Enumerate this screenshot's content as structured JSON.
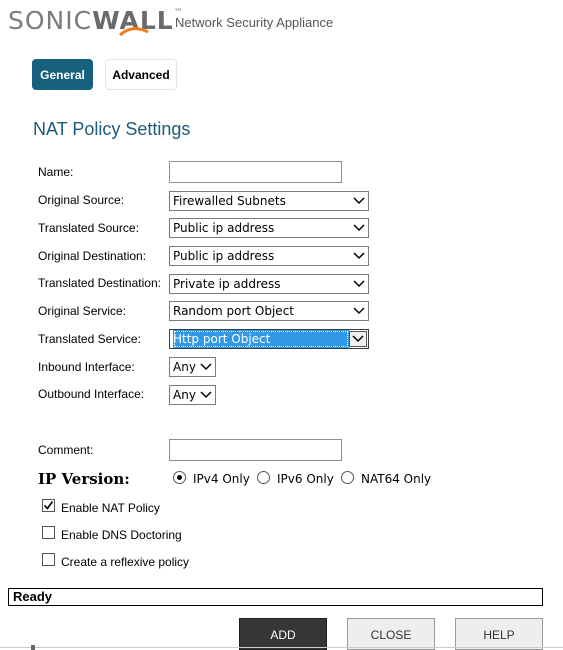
{
  "header": {
    "logo_part1": "SONIC",
    "logo_part2": "WALL",
    "logo_tm": "™",
    "subtitle": "Network Security Appliance"
  },
  "tabs": [
    {
      "label": "General",
      "active": true
    },
    {
      "label": "Advanced",
      "active": false
    }
  ],
  "section_title": "NAT Policy Settings",
  "form": {
    "name": {
      "label": "Name:",
      "value": ""
    },
    "original_source": {
      "label": "Original Source:",
      "value": "Firewalled Subnets"
    },
    "translated_source": {
      "label": "Translated Source:",
      "value": "Public ip address"
    },
    "original_destination": {
      "label": "Original Destination:",
      "value": "Public ip address"
    },
    "translated_destination": {
      "label": "Translated Destination:",
      "value": "Private ip address"
    },
    "original_service": {
      "label": "Original Service:",
      "value": "Random port Object"
    },
    "translated_service": {
      "label": "Translated Service:",
      "value": "Http port Object"
    },
    "inbound_interface": {
      "label": "Inbound Interface:",
      "value": "Any"
    },
    "outbound_interface": {
      "label": "Outbound Interface:",
      "value": "Any"
    },
    "comment": {
      "label": "Comment:",
      "value": ""
    }
  },
  "ip_version": {
    "label": "IP Version:",
    "options": [
      {
        "label": "IPv4 Only",
        "selected": true
      },
      {
        "label": "IPv6 Only",
        "selected": false
      },
      {
        "label": "NAT64 Only",
        "selected": false
      }
    ]
  },
  "checkboxes": [
    {
      "label": "Enable NAT Policy",
      "checked": true
    },
    {
      "label": "Enable DNS Doctoring",
      "checked": false
    },
    {
      "label": "Create a reflexive policy",
      "checked": false
    }
  ],
  "status_text": "Ready",
  "buttons": {
    "add": "ADD",
    "close": "CLOSE",
    "help": "HELP"
  },
  "icons": {
    "dropdown": "chevron-down-icon",
    "checkmark": "checkmark-icon",
    "logo_swoosh": "swoosh-icon"
  },
  "colors": {
    "accent": "#17617f",
    "title": "#1c5b7b",
    "highlight": "#3399e6",
    "primary_button": "#363636"
  }
}
